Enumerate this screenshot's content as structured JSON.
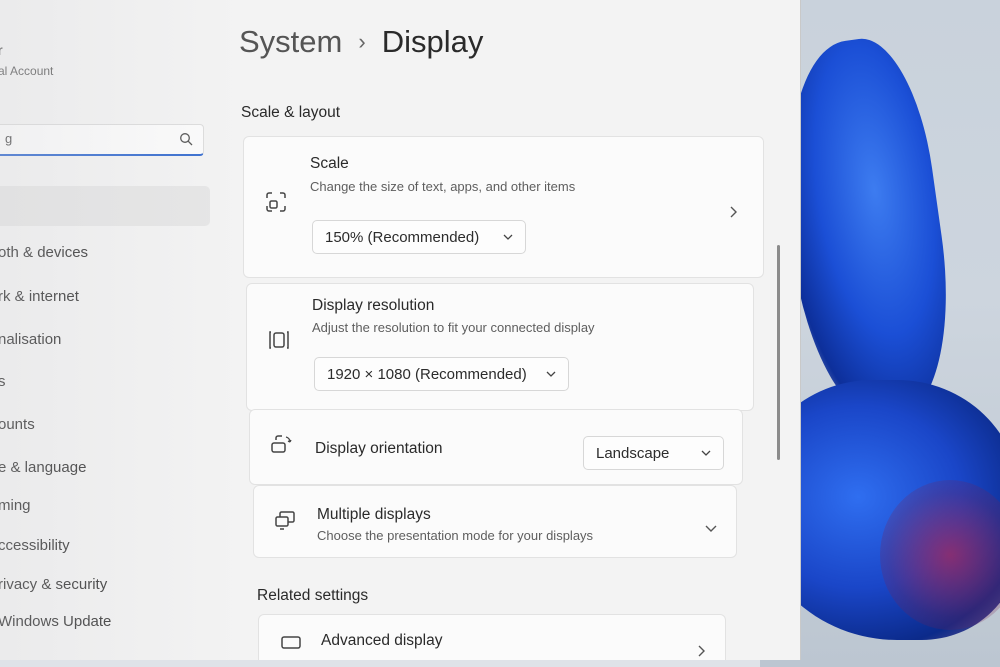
{
  "sidebar": {
    "user_name": "r",
    "user_subtitle": "al Account",
    "search_value": "g",
    "items": [
      {
        "label": "oth & devices"
      },
      {
        "label": "rk & internet"
      },
      {
        "label": "nalisation"
      },
      {
        "label": "s"
      },
      {
        "label": "ounts"
      },
      {
        "label": "e & language"
      },
      {
        "label": "ming"
      },
      {
        "label": "ccessibility"
      },
      {
        "label": "rivacy & security"
      },
      {
        "label": "Windows Update"
      }
    ]
  },
  "breadcrumb": {
    "parent": "System",
    "separator": "›",
    "current": "Display"
  },
  "scale_layout": {
    "section_title": "Scale & layout",
    "scale": {
      "title": "Scale",
      "subtitle": "Change the size of text, apps, and other items",
      "value": "150% (Recommended)",
      "icon": "scale-icon"
    },
    "resolution": {
      "title": "Display resolution",
      "subtitle": "Adjust the resolution to fit your connected display",
      "value": "1920 × 1080 (Recommended)",
      "icon": "resolution-icon"
    },
    "orientation": {
      "title": "Display orientation",
      "value": "Landscape",
      "icon": "orientation-icon"
    },
    "multiple": {
      "title": "Multiple displays",
      "subtitle": "Choose the presentation mode for your displays",
      "icon": "multiple-displays-icon"
    }
  },
  "related": {
    "section_title": "Related settings",
    "advanced": {
      "title": "Advanced display",
      "icon": "monitor-icon"
    }
  },
  "colors": {
    "accent": "#3a6fd0",
    "window_bg": "#f3f3f3",
    "card_bg": "#fbfbfb"
  }
}
